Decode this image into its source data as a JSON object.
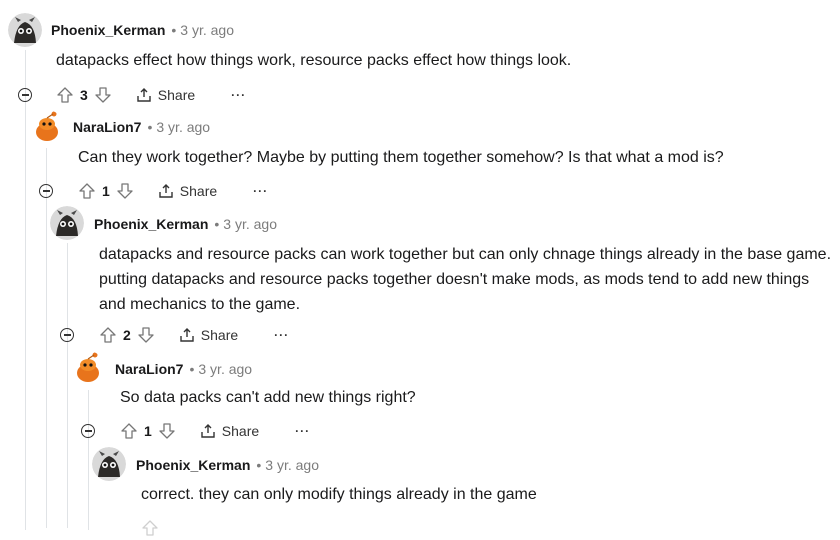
{
  "comments": [
    {
      "author": "Phoenix_Kerman",
      "age": "3 yr. ago",
      "body": "datapacks effect how things work, resource packs effect how things look.",
      "score": "3",
      "share_label": "Share",
      "more_label": "···",
      "avatar": "phoenix-avatar"
    },
    {
      "author": "NaraLion7",
      "age": "3 yr. ago",
      "body": "Can they work together? Maybe by putting them together somehow? Is that what a mod is?",
      "score": "1",
      "share_label": "Share",
      "more_label": "···",
      "avatar": "snoo-avatar"
    },
    {
      "author": "Phoenix_Kerman",
      "age": "3 yr. ago",
      "body": "datapacks and resource packs can work together but can only chnage things already in the base game. putting datapacks and resource packs together doesn't make mods, as mods tend to add new things and mechanics to the game.",
      "score": "2",
      "share_label": "Share",
      "more_label": "···",
      "avatar": "phoenix-avatar"
    },
    {
      "author": "NaraLion7",
      "age": "3 yr. ago",
      "body": "So data packs can't add new things right?",
      "score": "1",
      "share_label": "Share",
      "more_label": "···",
      "avatar": "snoo-avatar"
    },
    {
      "author": "Phoenix_Kerman",
      "age": "3 yr. ago",
      "body": "correct. they can only modify things already in the game",
      "avatar": "phoenix-avatar"
    }
  ],
  "separator": "•",
  "colors": {
    "text": "#1a1a1b",
    "meta": "#7c7c7c",
    "line": "#e0e3e6",
    "snoo": "#e8741c"
  }
}
